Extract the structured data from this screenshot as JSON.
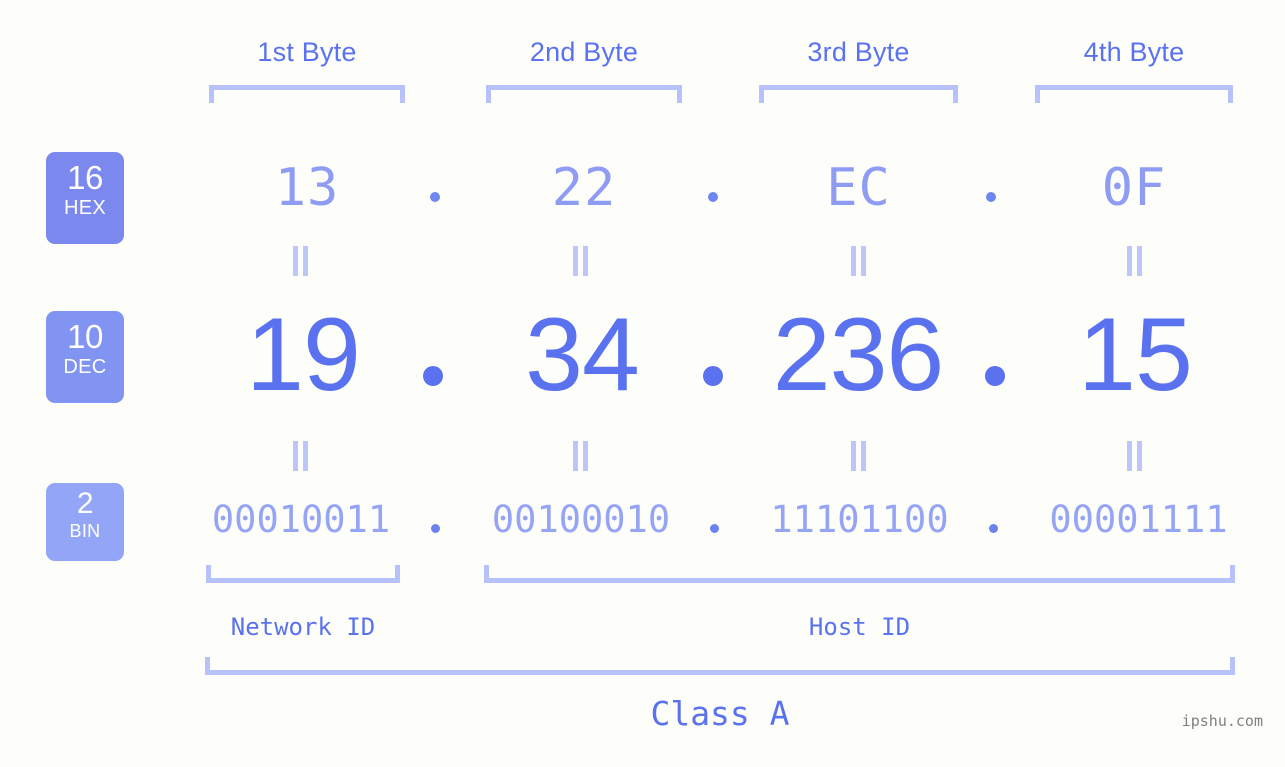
{
  "page": {
    "background": "#fdfefa",
    "accent_strong": "#5a72f0",
    "accent_mid": "#8e9cf4",
    "accent_light": "#b7c1fb",
    "watermark": "ipshu.com"
  },
  "byte_headers": [
    {
      "label": "1st Byte"
    },
    {
      "label": "2nd Byte"
    },
    {
      "label": "3rd Byte"
    },
    {
      "label": "4th Byte"
    }
  ],
  "bases": [
    {
      "number": "16",
      "name": "HEX",
      "color": "#7b89ee"
    },
    {
      "number": "10",
      "name": "DEC",
      "color": "#8294f2"
    },
    {
      "number": "2",
      "name": "BIN",
      "color": "#93a5f6"
    }
  ],
  "separator": ".",
  "rows": {
    "hex": {
      "values": [
        "13",
        "22",
        "EC",
        "0F"
      ]
    },
    "dec": {
      "values": [
        "19",
        "34",
        "236",
        "15"
      ]
    },
    "bin": {
      "values": [
        "00010011",
        "00100010",
        "11101100",
        "00001111"
      ]
    }
  },
  "equals_marks": {
    "hex_to_dec": [
      "=",
      "=",
      "=",
      "="
    ],
    "dec_to_bin": [
      "=",
      "=",
      "=",
      "="
    ]
  },
  "id_sections": [
    {
      "label": "Network ID"
    },
    {
      "label": "Host ID"
    }
  ],
  "class": {
    "label": "Class A"
  }
}
